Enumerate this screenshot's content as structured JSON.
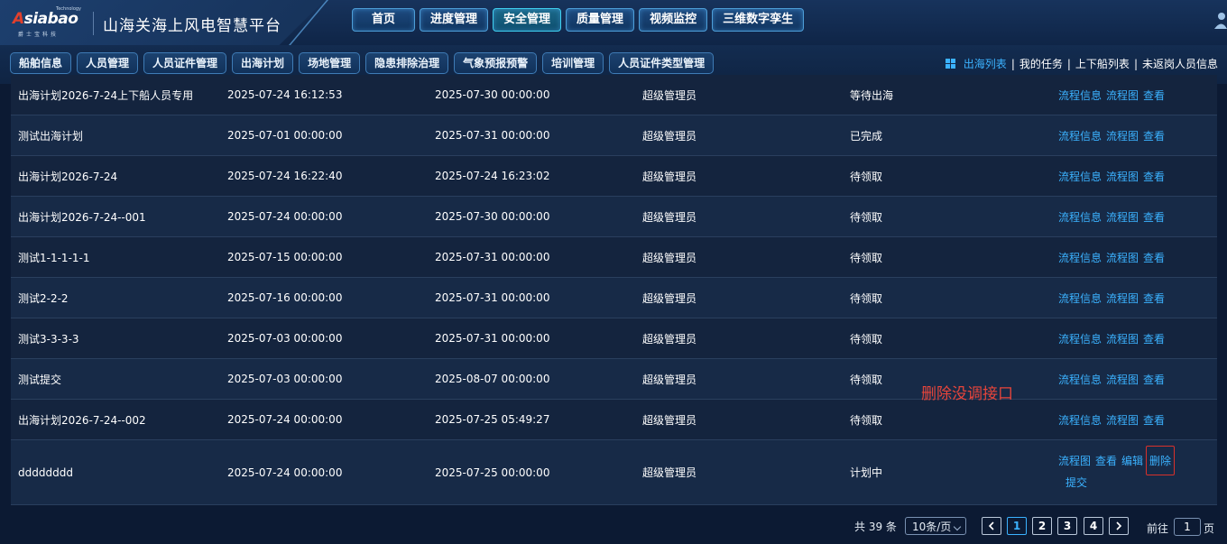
{
  "brand": {
    "logo_text": "Asiabao",
    "logo_tagline": "Technology",
    "logo_sub": "爵士宝科技",
    "app_title": "山海关海上风电智慧平台"
  },
  "top_nav": [
    "首页",
    "进度管理",
    "安全管理",
    "质量管理",
    "视频监控",
    "三维数字孪生"
  ],
  "top_nav_active": "安全管理",
  "sub_nav": [
    "船舶信息",
    "人员管理",
    "人员证件管理",
    "出海计划",
    "场地管理",
    "隐患排除治理",
    "气象预报预警",
    "培训管理",
    "人员证件类型管理"
  ],
  "sub_right": {
    "list_label": "出海列表",
    "tasks_label": "我的任务",
    "boarding_label": "上下船列表",
    "not_returned_label": "未返岗人员信息"
  },
  "rows": [
    {
      "name": "出海计划2026-7-24上下船人员专用",
      "start": "2025-07-24 16:12:53",
      "end": "2025-07-30 00:00:00",
      "owner": "超级管理员",
      "status": "等待出海",
      "ops": [
        "流程信息",
        "流程图",
        "查看"
      ]
    },
    {
      "name": "测试出海计划",
      "start": "2025-07-01 00:00:00",
      "end": "2025-07-31 00:00:00",
      "owner": "超级管理员",
      "status": "已完成",
      "ops": [
        "流程信息",
        "流程图",
        "查看"
      ]
    },
    {
      "name": "出海计划2026-7-24",
      "start": "2025-07-24 16:22:40",
      "end": "2025-07-24 16:23:02",
      "owner": "超级管理员",
      "status": "待领取",
      "ops": [
        "流程信息",
        "流程图",
        "查看"
      ]
    },
    {
      "name": "出海计划2026-7-24--001",
      "start": "2025-07-24 00:00:00",
      "end": "2025-07-30 00:00:00",
      "owner": "超级管理员",
      "status": "待领取",
      "ops": [
        "流程信息",
        "流程图",
        "查看"
      ]
    },
    {
      "name": "测试1-1-1-1-1",
      "start": "2025-07-15 00:00:00",
      "end": "2025-07-31 00:00:00",
      "owner": "超级管理员",
      "status": "待领取",
      "ops": [
        "流程信息",
        "流程图",
        "查看"
      ]
    },
    {
      "name": "测试2-2-2",
      "start": "2025-07-16 00:00:00",
      "end": "2025-07-31 00:00:00",
      "owner": "超级管理员",
      "status": "待领取",
      "ops": [
        "流程信息",
        "流程图",
        "查看"
      ]
    },
    {
      "name": "测试3-3-3-3",
      "start": "2025-07-03 00:00:00",
      "end": "2025-07-31 00:00:00",
      "owner": "超级管理员",
      "status": "待领取",
      "ops": [
        "流程信息",
        "流程图",
        "查看"
      ]
    },
    {
      "name": "测试提交",
      "start": "2025-07-03 00:00:00",
      "end": "2025-08-07 00:00:00",
      "owner": "超级管理员",
      "status": "待领取",
      "ops": [
        "流程信息",
        "流程图",
        "查看"
      ]
    },
    {
      "name": "出海计划2026-7-24--002",
      "start": "2025-07-24 00:00:00",
      "end": "2025-07-25 05:49:27",
      "owner": "超级管理员",
      "status": "待领取",
      "ops": [
        "流程信息",
        "流程图",
        "查看"
      ]
    },
    {
      "name": "dddddddd",
      "start": "2025-07-24 00:00:00",
      "end": "2025-07-25 00:00:00",
      "owner": "超级管理员",
      "status": "计划中",
      "ops": [
        "流程图",
        "查看",
        "编辑",
        "删除",
        "提交"
      ]
    }
  ],
  "annotation": "删除没调接口",
  "pager": {
    "total": "共 39 条",
    "page_size": "10条/页",
    "pages": [
      "1",
      "2",
      "3",
      "4"
    ],
    "current": "1",
    "goto_label": "前往",
    "goto_value": "1",
    "goto_suffix": "页"
  },
  "colors": {
    "link": "#3bb2ff",
    "annotation": "#e8453b",
    "highlight_box": "#d8312b"
  }
}
